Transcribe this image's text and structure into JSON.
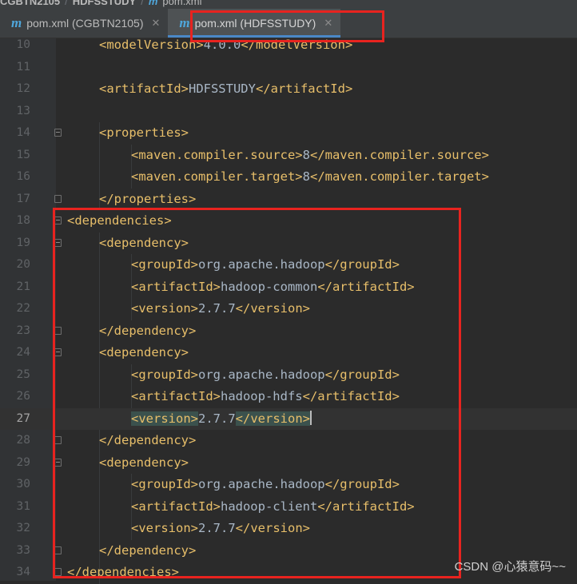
{
  "breadcrumb": {
    "project": "CGBTN2105",
    "module": "HDFSSTUDY",
    "file_icon": "m",
    "file": "pom.xml"
  },
  "tabs": [
    {
      "icon": "m",
      "label": "pom.xml (CGBTN2105)",
      "active": false
    },
    {
      "icon": "m",
      "label": "pom.xml (HDFSSTUDY)",
      "active": true
    }
  ],
  "close_glyph": "✕",
  "lines": [
    {
      "n": "10",
      "indent": 1,
      "parts": [
        [
          "tag",
          "<modelVersion>"
        ],
        [
          "txt",
          "4.0.0"
        ],
        [
          "tag",
          "</modelVersion>"
        ]
      ]
    },
    {
      "n": "11",
      "indent": 0,
      "parts": []
    },
    {
      "n": "12",
      "indent": 1,
      "parts": [
        [
          "tag",
          "<artifactId>"
        ],
        [
          "txt",
          "HDFSSTUDY"
        ],
        [
          "tag",
          "</artifactId>"
        ]
      ]
    },
    {
      "n": "13",
      "indent": 0,
      "parts": []
    },
    {
      "n": "14",
      "indent": 1,
      "fold": "open",
      "parts": [
        [
          "tag",
          "<properties>"
        ]
      ]
    },
    {
      "n": "15",
      "indent": 2,
      "parts": [
        [
          "tag",
          "<maven.compiler.source>"
        ],
        [
          "txt",
          "8"
        ],
        [
          "tag",
          "</maven.compiler.source>"
        ]
      ]
    },
    {
      "n": "16",
      "indent": 2,
      "parts": [
        [
          "tag",
          "<maven.compiler.target>"
        ],
        [
          "txt",
          "8"
        ],
        [
          "tag",
          "</maven.compiler.target>"
        ]
      ]
    },
    {
      "n": "17",
      "indent": 1,
      "fold": "close",
      "parts": [
        [
          "tag",
          "</properties>"
        ]
      ]
    },
    {
      "n": "18",
      "indent": 0,
      "fold": "open",
      "parts": [
        [
          "tag",
          "<dependencies>"
        ]
      ]
    },
    {
      "n": "19",
      "indent": 1,
      "fold": "open",
      "parts": [
        [
          "tag",
          "<dependency>"
        ]
      ]
    },
    {
      "n": "20",
      "indent": 2,
      "parts": [
        [
          "tag",
          "<groupId>"
        ],
        [
          "txt",
          "org.apache.hadoop"
        ],
        [
          "tag",
          "</groupId>"
        ]
      ]
    },
    {
      "n": "21",
      "indent": 2,
      "parts": [
        [
          "tag",
          "<artifactId>"
        ],
        [
          "txt",
          "hadoop-common"
        ],
        [
          "tag",
          "</artifactId>"
        ]
      ]
    },
    {
      "n": "22",
      "indent": 2,
      "parts": [
        [
          "tag",
          "<version>"
        ],
        [
          "txt",
          "2.7.7"
        ],
        [
          "tag",
          "</version>"
        ]
      ]
    },
    {
      "n": "23",
      "indent": 1,
      "fold": "close",
      "parts": [
        [
          "tag",
          "</dependency>"
        ]
      ]
    },
    {
      "n": "24",
      "indent": 1,
      "fold": "open",
      "parts": [
        [
          "tag",
          "<dependency>"
        ]
      ]
    },
    {
      "n": "25",
      "indent": 2,
      "parts": [
        [
          "tag",
          "<groupId>"
        ],
        [
          "txt",
          "org.apache.hadoop"
        ],
        [
          "tag",
          "</groupId>"
        ]
      ]
    },
    {
      "n": "26",
      "indent": 2,
      "parts": [
        [
          "tag",
          "<artifactId>"
        ],
        [
          "txt",
          "hadoop-hdfs"
        ],
        [
          "tag",
          "</artifactId>"
        ]
      ]
    },
    {
      "n": "27",
      "indent": 2,
      "current": true,
      "parts": [
        [
          "hl",
          "<version>"
        ],
        [
          "txt",
          "2.7.7"
        ],
        [
          "hl",
          "</version>"
        ]
      ]
    },
    {
      "n": "28",
      "indent": 1,
      "fold": "close",
      "parts": [
        [
          "tag",
          "</dependency>"
        ]
      ]
    },
    {
      "n": "29",
      "indent": 1,
      "fold": "open",
      "parts": [
        [
          "tag",
          "<dependency>"
        ]
      ]
    },
    {
      "n": "30",
      "indent": 2,
      "parts": [
        [
          "tag",
          "<groupId>"
        ],
        [
          "txt",
          "org.apache.hadoop"
        ],
        [
          "tag",
          "</groupId>"
        ]
      ]
    },
    {
      "n": "31",
      "indent": 2,
      "parts": [
        [
          "tag",
          "<artifactId>"
        ],
        [
          "txt",
          "hadoop-client"
        ],
        [
          "tag",
          "</artifactId>"
        ]
      ]
    },
    {
      "n": "32",
      "indent": 2,
      "parts": [
        [
          "tag",
          "<version>"
        ],
        [
          "txt",
          "2.7.7"
        ],
        [
          "tag",
          "</version>"
        ]
      ]
    },
    {
      "n": "33",
      "indent": 1,
      "fold": "close",
      "parts": [
        [
          "tag",
          "</dependency>"
        ]
      ]
    },
    {
      "n": "34",
      "indent": 0,
      "fold": "close",
      "parts": [
        [
          "tag",
          "</dependencies>"
        ]
      ]
    }
  ],
  "annotation_color": "#e8231f",
  "watermark": "CSDN @心猿意码~~"
}
